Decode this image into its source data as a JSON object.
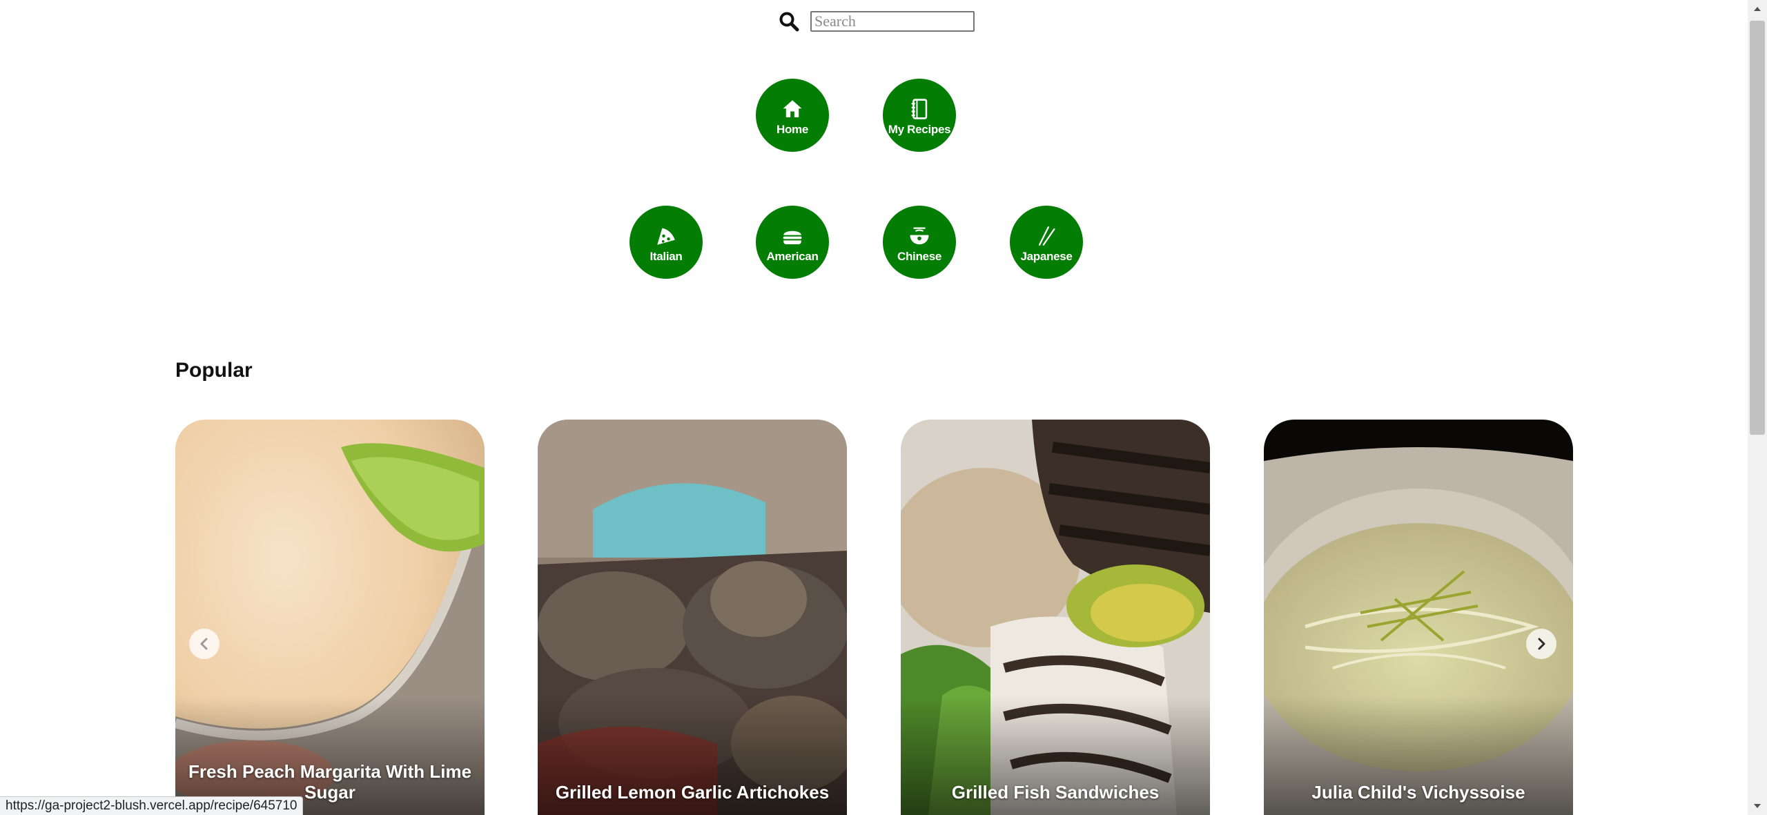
{
  "search": {
    "placeholder": "Search",
    "value": ""
  },
  "nav": {
    "primary": [
      {
        "label": "Home",
        "icon": "home-icon"
      },
      {
        "label": "My Recipes",
        "icon": "recipe-book-icon"
      }
    ],
    "cuisines": [
      {
        "label": "Italian",
        "icon": "pizza-icon"
      },
      {
        "label": "American",
        "icon": "burger-icon"
      },
      {
        "label": "Chinese",
        "icon": "noodle-bowl-icon"
      },
      {
        "label": "Japanese",
        "icon": "chopsticks-icon"
      }
    ]
  },
  "popular": {
    "title": "Popular",
    "cards": [
      {
        "title": "Fresh Peach Margarita With Lime Sugar"
      },
      {
        "title": "Grilled Lemon Garlic Artichokes"
      },
      {
        "title": "Grilled Fish Sandwiches"
      },
      {
        "title": "Julia Child's Vichyssoise"
      }
    ]
  },
  "status_bar": {
    "url": "https://ga-project2-blush.vercel.app/recipe/645710"
  },
  "colors": {
    "accent": "#037d03",
    "background": "#ffffff"
  }
}
